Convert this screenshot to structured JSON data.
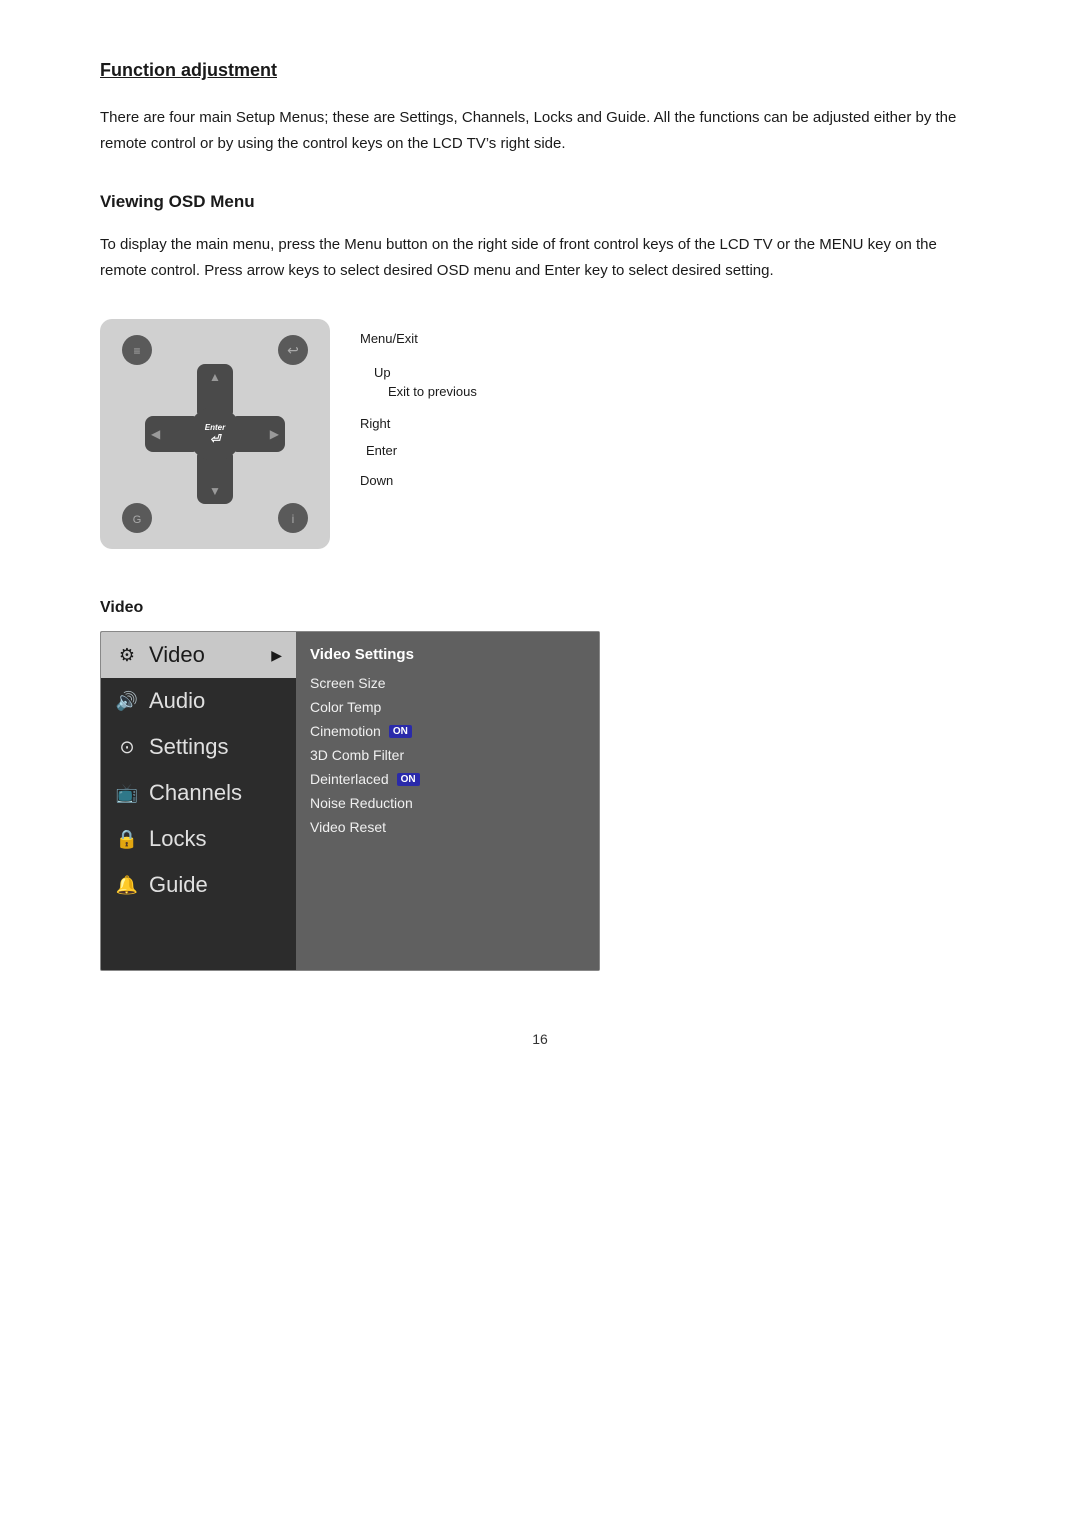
{
  "page": {
    "number": "16"
  },
  "function_adjustment": {
    "title": "Function adjustment",
    "body": "There are four main Setup Menus; these are Settings, Channels, Locks and Guide. All the functions can be adjusted either by the remote control or by using the control keys on the LCD TV’s right side."
  },
  "viewing_osd": {
    "title": "Viewing OSD Menu",
    "body": "To display the main menu, press the Menu button on the right side of front control keys of the LCD TV or the MENU key on the remote control. Press arrow keys to select desired OSD menu and Enter key to select desired setting."
  },
  "remote_labels": {
    "menu_exit": "Menu/Exit",
    "up": "Up",
    "exit_prev": "Exit to previous",
    "right": "Right",
    "enter": "Enter",
    "down": "Down"
  },
  "video_section": {
    "title": "Video",
    "menu_items": [
      {
        "id": "video",
        "icon": "⚙",
        "label": "Video",
        "active": true
      },
      {
        "id": "audio",
        "icon": "🔊",
        "label": "Audio",
        "active": false
      },
      {
        "id": "settings",
        "icon": "⊙",
        "label": "Settings",
        "active": false
      },
      {
        "id": "channels",
        "icon": "📺",
        "label": "Channels",
        "active": false
      },
      {
        "id": "locks",
        "icon": "🔒",
        "label": "Locks",
        "active": false
      },
      {
        "id": "guide",
        "icon": "ℹ",
        "label": "Guide",
        "active": false
      }
    ],
    "submenu_items": [
      {
        "label": "Video Settings",
        "header": true,
        "on": false
      },
      {
        "label": "Screen Size",
        "header": false,
        "on": false
      },
      {
        "label": "Color Temp",
        "header": false,
        "on": false
      },
      {
        "label": "Cinemotion",
        "header": false,
        "on": true
      },
      {
        "label": "3D Comb Filter",
        "header": false,
        "on": false
      },
      {
        "label": "Deinterlaced",
        "header": false,
        "on": true
      },
      {
        "label": "Noise Reduction",
        "header": false,
        "on": false
      },
      {
        "label": "Video Reset",
        "header": false,
        "on": false
      }
    ],
    "on_label": "ON"
  }
}
